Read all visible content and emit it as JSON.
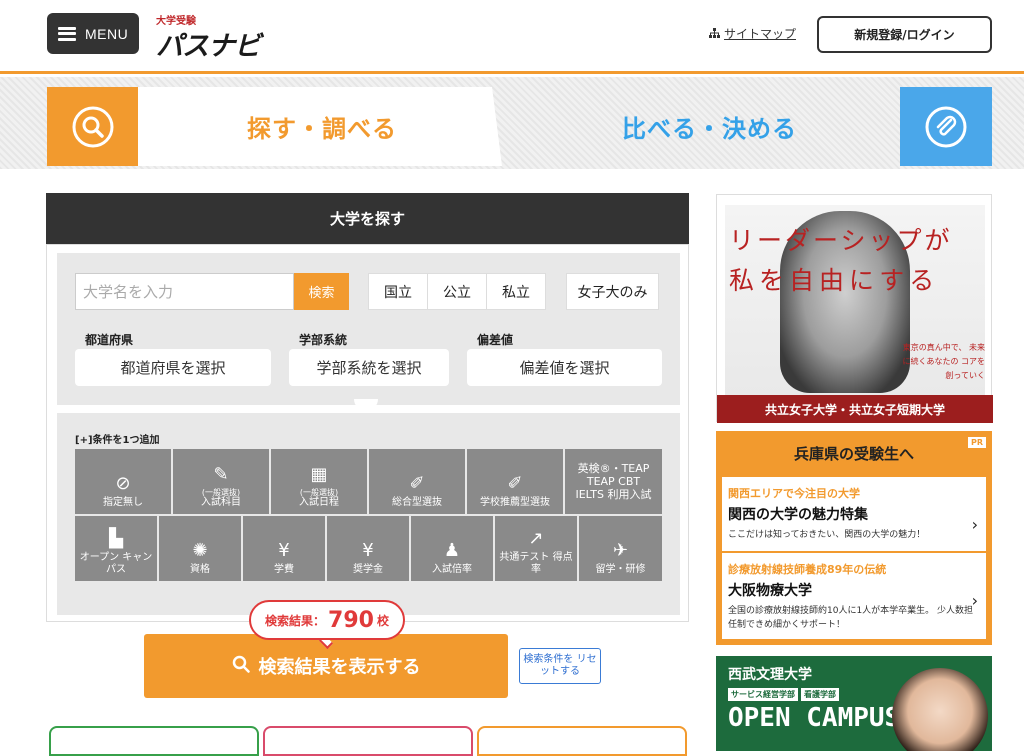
{
  "header": {
    "menu_label": "MENU",
    "logo_small": "大学受験",
    "logo_big": "パスナビ",
    "sitemap_label": "サイトマップ",
    "login_label": "新規登録/ログイン"
  },
  "tabs": {
    "search_label": "探す・調べる",
    "compare_label": "比べる・決める"
  },
  "search": {
    "title": "大学を探す",
    "input_placeholder": "大学名を入力",
    "search_button": "検索",
    "types": [
      "国立",
      "公立",
      "私立"
    ],
    "women_only": "女子大のみ",
    "filters": [
      {
        "label": "都道府県",
        "value": "都道府県を選択"
      },
      {
        "label": "学部系統",
        "value": "学部系統を選択"
      },
      {
        "label": "偏差値",
        "value": "偏差値を選択"
      }
    ],
    "add_condition_label": "[+]条件を1つ追加",
    "conditions_row1": [
      {
        "icon": "⊘",
        "t1": "",
        "t2": "指定無し"
      },
      {
        "icon": "✎",
        "t1": "(一般選抜)",
        "t2": "入試科目"
      },
      {
        "icon": "▦",
        "t1": "(一般選抜)",
        "t2": "入試日程"
      },
      {
        "icon": "✐",
        "t1": "",
        "t2": "総合型選抜"
      },
      {
        "icon": "✐",
        "t1": "",
        "t2": "学校推薦型選抜"
      },
      {
        "icon": "",
        "t1": "",
        "t2": "英検®・TEAP TEAP CBT IELTS 利用入試"
      }
    ],
    "conditions_row2": [
      {
        "icon": "▙",
        "t2": "オープン キャンパス"
      },
      {
        "icon": "✺",
        "t2": "資格"
      },
      {
        "icon": "¥",
        "t2": "学費"
      },
      {
        "icon": "¥",
        "t2": "奨学金"
      },
      {
        "icon": "♟",
        "t2": "入試倍率"
      },
      {
        "icon": "↗",
        "t2": "共通テスト 得点率"
      },
      {
        "icon": "✈",
        "t2": "留学・研修"
      }
    ],
    "result_count_label": "検索結果：",
    "result_count": "790",
    "result_count_unit": "校",
    "show_results": "検索結果を表示する",
    "reset_label": "検索条件を リセットする"
  },
  "sidebar": {
    "ad1": {
      "copy1": "リーダーシップが",
      "copy2": "私を自由にする",
      "sub": "東京の真ん中で、 未来に続くあなたの コアを創っていく",
      "band": "共立女子大学・共立女子短期大学"
    },
    "hyogo": {
      "title": "兵庫県の受験生へ",
      "pr": "PR",
      "cards": [
        {
          "kicker": "関西エリアで今注目の大学",
          "headline": "関西の大学の魅力特集",
          "desc": "ここだけは知っておきたい、関西の大学の魅力！"
        },
        {
          "kicker": "診療放射線技師養成89年の伝統",
          "headline": "大阪物療大学",
          "desc": "全国の診療放射線技師約10人に1人が本学卒業生。 少人数担任制できめ細かくサポート！"
        }
      ]
    },
    "ad3": {
      "logo": "西武文理大学",
      "tags": [
        "サービス経営学部",
        "看護学部"
      ],
      "big": "OPEN CAMPUS"
    }
  },
  "colors": {
    "accent": "#f29a2e",
    "blue": "#4aa7ea",
    "dark": "#333333"
  }
}
